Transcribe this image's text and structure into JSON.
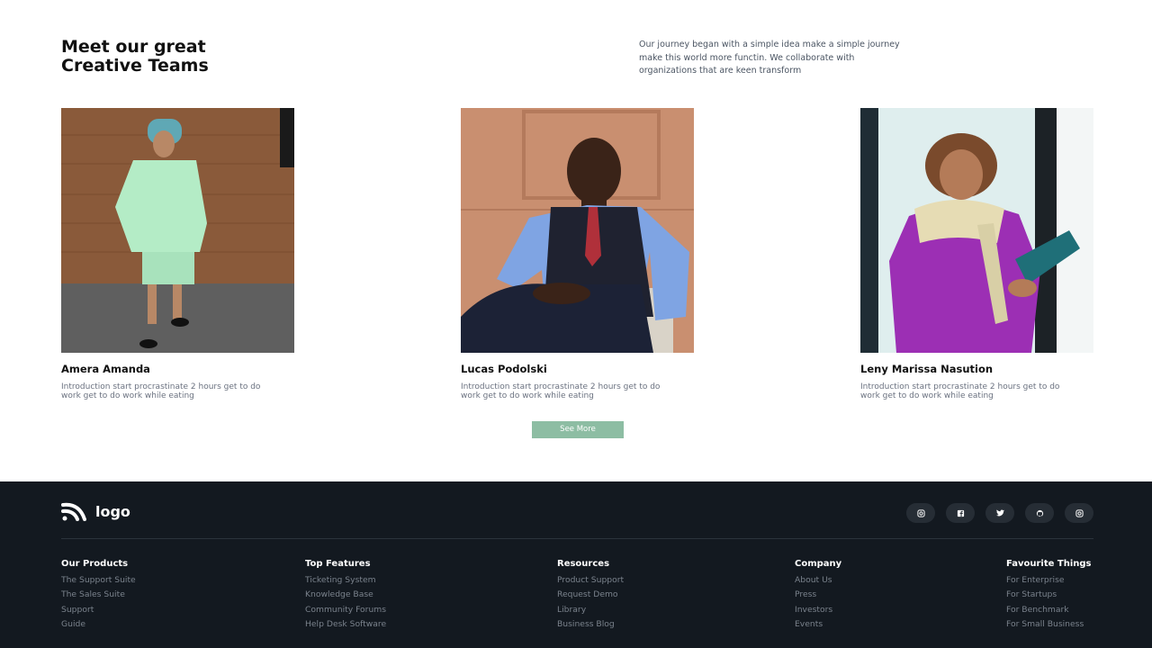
{
  "team": {
    "heading_line1": "Meet our great",
    "heading_line2": "Creative Teams",
    "intro": "Our journey began with a simple idea make a simple journey make this world more functin. We collaborate with organizations that are keen transform",
    "members": [
      {
        "name": "Amera Amanda",
        "desc": "Introduction start procrastinate 2 hours get to do work get to do work while eating"
      },
      {
        "name": "Lucas Podolski",
        "desc": "Introduction start procrastinate 2 hours get to do work get to do work while eating"
      },
      {
        "name": "Leny Marissa Nasution",
        "desc": "Introduction start procrastinate 2 hours get to do work get to do work while eating"
      }
    ],
    "see_more_label": "See More",
    "accent_color": "#8dbda3"
  },
  "footer": {
    "logo_text": "logo",
    "background_color": "#131920",
    "socials": [
      "instagram-icon",
      "facebook-icon",
      "twitter-icon",
      "github-icon",
      "instagram-icon"
    ],
    "columns": [
      {
        "title": "Our Products",
        "links": [
          "The Support Suite",
          "The Sales Suite",
          "Support",
          "Guide"
        ]
      },
      {
        "title": "Top Features",
        "links": [
          "Ticketing System",
          "Knowledge Base",
          "Community Forums",
          "Help Desk Software"
        ]
      },
      {
        "title": "Resources",
        "links": [
          "Product Support",
          "Request Demo",
          "Library",
          "Business Blog"
        ]
      },
      {
        "title": "Company",
        "links": [
          "About Us",
          "Press",
          "Investors",
          "Events"
        ]
      },
      {
        "title": "Favourite Things",
        "links": [
          "For Enterprise",
          "For Startups",
          "For Benchmark",
          "For Small Business"
        ]
      }
    ]
  }
}
